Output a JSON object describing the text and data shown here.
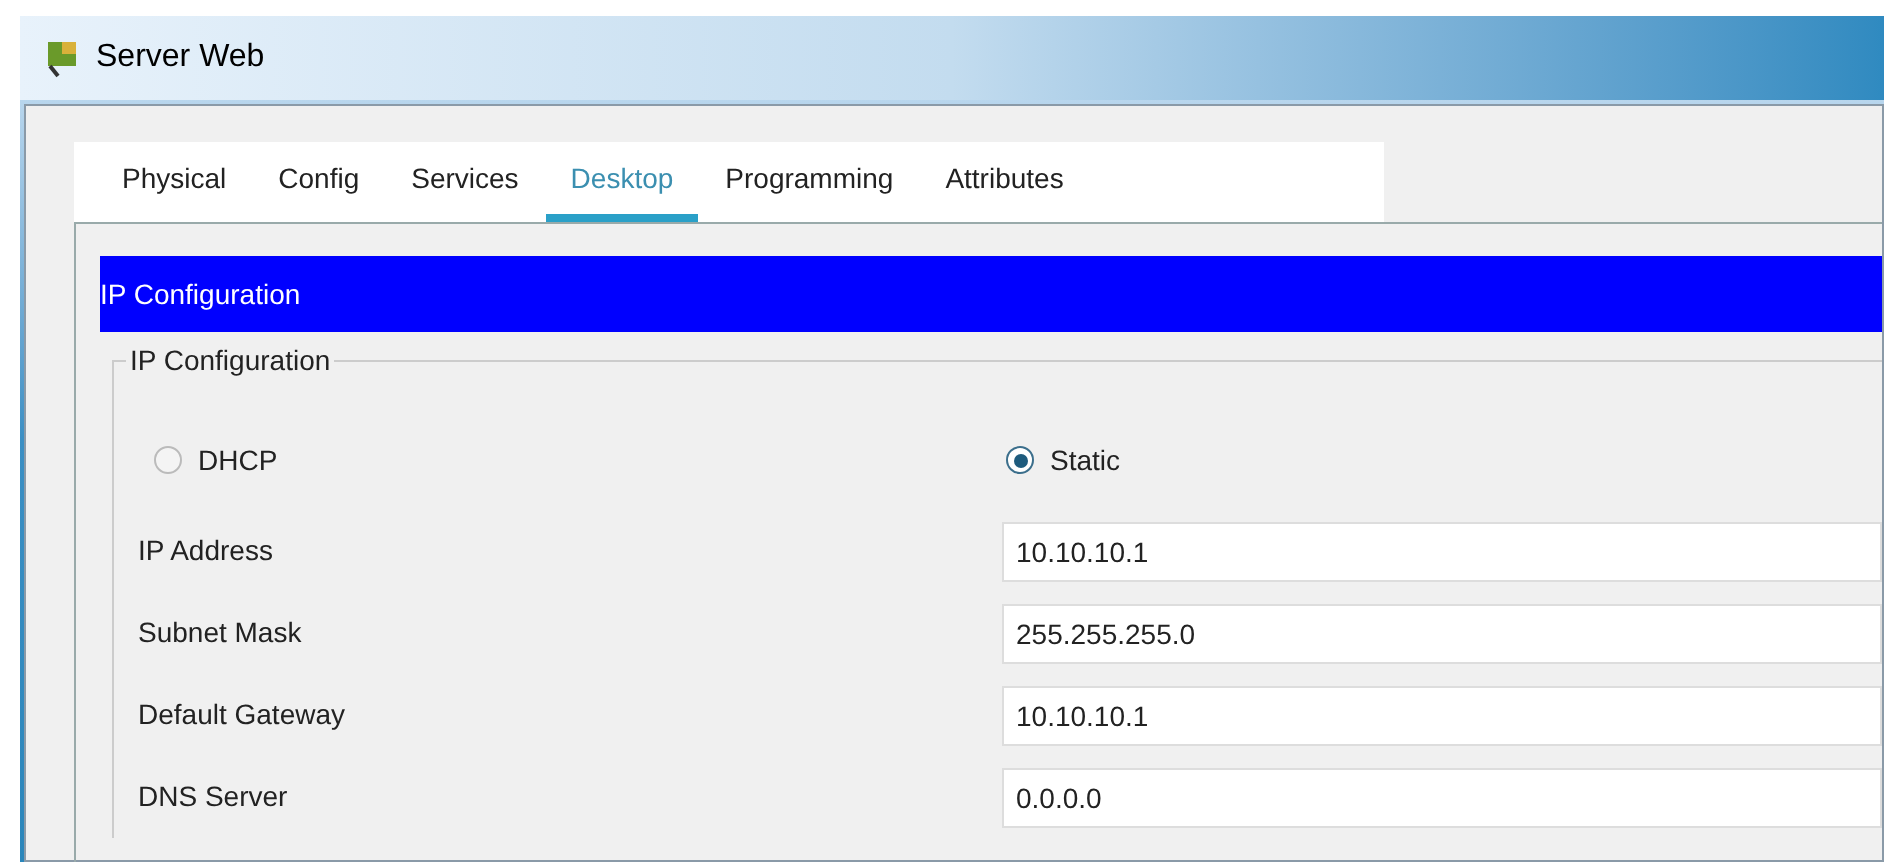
{
  "window": {
    "title": "Server Web"
  },
  "tabs": [
    {
      "label": "Physical",
      "selected": false
    },
    {
      "label": "Config",
      "selected": false
    },
    {
      "label": "Services",
      "selected": false
    },
    {
      "label": "Desktop",
      "selected": true
    },
    {
      "label": "Programming",
      "selected": false
    },
    {
      "label": "Attributes",
      "selected": false
    }
  ],
  "panel": {
    "title": "IP Configuration",
    "group_title": "IP Configuration",
    "modes": [
      {
        "label": "DHCP",
        "selected": false
      },
      {
        "label": "Static",
        "selected": true
      }
    ],
    "fields": [
      {
        "label": "IP Address",
        "value": "10.10.10.1"
      },
      {
        "label": "Subnet Mask",
        "value": "255.255.255.0"
      },
      {
        "label": "Default Gateway",
        "value": "10.10.10.1"
      },
      {
        "label": "DNS Server",
        "value": "0.0.0.0"
      }
    ]
  }
}
